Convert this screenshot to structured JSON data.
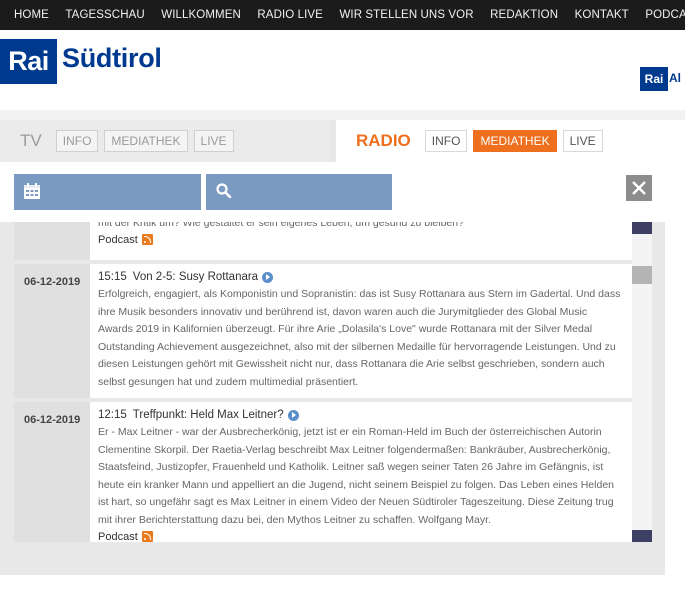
{
  "nav": {
    "items": [
      "HOME",
      "TAGESSCHAU",
      "WILLKOMMEN",
      "RADIO LIVE",
      "WIR STELLEN UNS VOR",
      "REDAKTION",
      "KONTAKT",
      "PODCAST"
    ]
  },
  "header": {
    "logo_rai": "Rai",
    "logo_name": "Südtirol",
    "logo_small_rai": "Rai",
    "logo_small_text": "Al"
  },
  "tv": {
    "label": "TV",
    "tabs": [
      "INFO",
      "MEDIATHEK",
      "LIVE"
    ]
  },
  "radio": {
    "label": "RADIO",
    "tabs": [
      "INFO",
      "MEDIATHEK",
      "LIVE"
    ],
    "active_tab": "MEDIATHEK"
  },
  "icons": {
    "calendar": "calendar-icon",
    "search": "search-icon",
    "close": "close-icon"
  },
  "colors": {
    "accent_orange": "#ee6f1e",
    "rai_blue": "#003a8f",
    "button_blue": "#7a9ac2"
  },
  "items": [
    {
      "date": "",
      "time": "",
      "title": "",
      "desc": "mit der Kritik um? Wie gestaltet er sein eigenes Leben, um gesund zu bleiben?",
      "podcast": "Podcast"
    },
    {
      "date": "06-12-2019",
      "time": "15:15",
      "title": "Von 2-5: Susy Rottanara",
      "desc": "Erfolgreich, engagiert, als Komponistin und Sopranistin: das ist Susy Rottanara aus Stern im Gadertal. Und dass ihre Musik besonders innovativ und berührend ist, davon waren auch die Jurymitglieder des Global Music Awards 2019 in Kalifornien überzeugt. Für ihre Arie „Dolasila's Love\" wurde Rottanara mit der Silver Medal Outstanding Achievement ausgezeichnet, also mit der silbernen Medaille für hervorragende Leistungen. Und zu diesen Leistungen gehört mit Gewissheit nicht nur, dass Rottanara die Arie selbst geschrieben, sondern auch selbst gesungen hat und zudem multimedial präsentiert.",
      "podcast": ""
    },
    {
      "date": "06-12-2019",
      "time": "12:15",
      "title": "Treffpunkt: Held Max Leitner?",
      "desc": "Er - Max Leitner - war der Ausbrecherkönig, jetzt ist er ein Roman-Held im Buch der österreichischen Autorin Clementine Skorpil. Der Raetia-Verlag beschreibt Max Leitner folgendermaßen: Bankräuber, Ausbrecherkönig, Staatsfeind, Justizopfer, Frauenheld und Katholik. Leitner saß wegen seiner Taten 26 Jahre im Gefängnis, ist heute ein kranker Mann und appelliert an die Jugend, nicht seinem Beispiel zu folgen. Das Leben eines Helden ist hart, so ungefähr sagt es Max Leitner in einem Video der Neuen Südtiroler Tageszeitung. Diese Zeitung trug mit ihrer Berichterstattung dazu bei, den Mythos Leitner zu schaffen. Wolfgang Mayr.",
      "podcast": "Podcast"
    }
  ]
}
